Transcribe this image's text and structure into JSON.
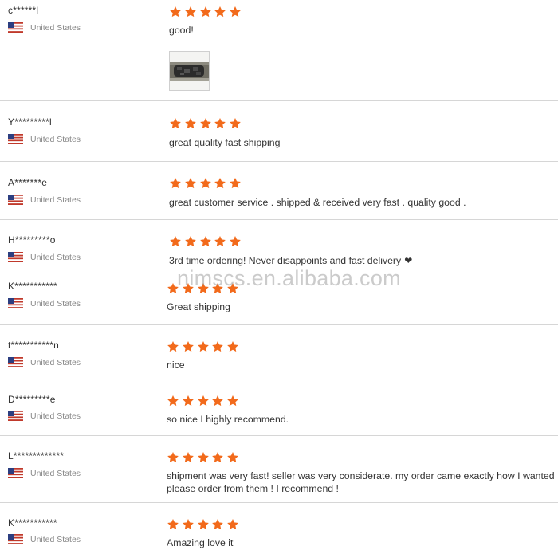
{
  "colors": {
    "star": "#f26a1b",
    "flag_stripe": "#c0392b",
    "flag_canton": "#2c3e80"
  },
  "watermark": "nimscs.en.alibaba.com",
  "reviews": [
    {
      "name": "c******l",
      "country": "United States",
      "rating": 5,
      "text": "good!",
      "has_photo": true
    },
    {
      "name": "Y*********l",
      "country": "United States",
      "rating": 5,
      "text": "great quality fast shipping"
    },
    {
      "name": "A*******e",
      "country": "United States",
      "rating": 5,
      "text": "great customer service . shipped & received very fast . quality good ."
    },
    {
      "name": "H*********o",
      "country": "United States",
      "rating": 5,
      "text": "3rd time ordering! Never disappoints and fast delivery"
    },
    {
      "name": "K***********",
      "country": "United States",
      "rating": 5,
      "text": "Great shipping"
    },
    {
      "name": "t***********n",
      "country": "United States",
      "rating": 5,
      "text": "nice"
    },
    {
      "name": "D*********e",
      "country": "United States",
      "rating": 5,
      "text": "so nice I highly recommend."
    },
    {
      "name": "L*************",
      "country": "United States",
      "rating": 5,
      "text": "shipment was very fast! seller was very considerate. my order came exactly how I wanted !",
      "text2": "please order from them ! I recommend !"
    },
    {
      "name": "K***********",
      "country": "United States",
      "rating": 5,
      "text": "Amazing love it"
    }
  ]
}
